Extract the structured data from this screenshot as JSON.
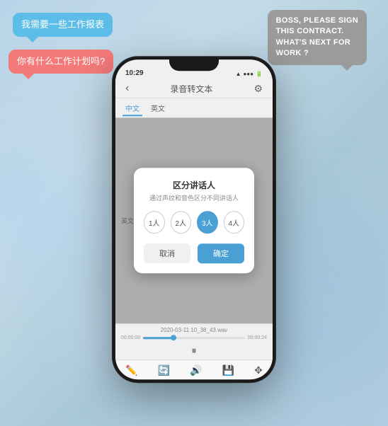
{
  "background": {
    "gradient_start": "#b8d4e8",
    "gradient_end": "#b0cce0"
  },
  "bubbles": {
    "top_left_line1": "我需要一些工作报表",
    "top_left_line2": "你有什么工作计划吗?",
    "top_right_line1": "BOSS, PLEASE SIGN",
    "top_right_line2": "THIS CONTRACT.",
    "top_right_line3": "WHAT'S NEXT FOR",
    "top_right_line4": "WORK ?"
  },
  "phone": {
    "status": {
      "time": "10:29",
      "signal": "↑↓",
      "battery": "6d",
      "wifi": "◀"
    },
    "title_bar": {
      "back_icon": "‹",
      "title": "录音转文本",
      "settings_icon": "⚙"
    },
    "lang_tabs": {
      "tab1": "中文",
      "tab2": "英文"
    },
    "lang_label": "英文",
    "dialog": {
      "title": "区分讲话人",
      "subtitle": "通过声纹和音色区分不同讲话人",
      "speaker_options": [
        "1人",
        "2人",
        "3人",
        "4人"
      ],
      "active_option": 2,
      "cancel_label": "取消",
      "confirm_label": "确定"
    },
    "player": {
      "filename": "2020-03-11 10_38_43.wav",
      "time_start": "00:00:00",
      "time_end": "00:00:24",
      "progress_percent": 30
    },
    "toolbar_icons": [
      "pencil-icon",
      "refresh-icon",
      "volume-icon",
      "save-icon",
      "move-icon"
    ]
  }
}
